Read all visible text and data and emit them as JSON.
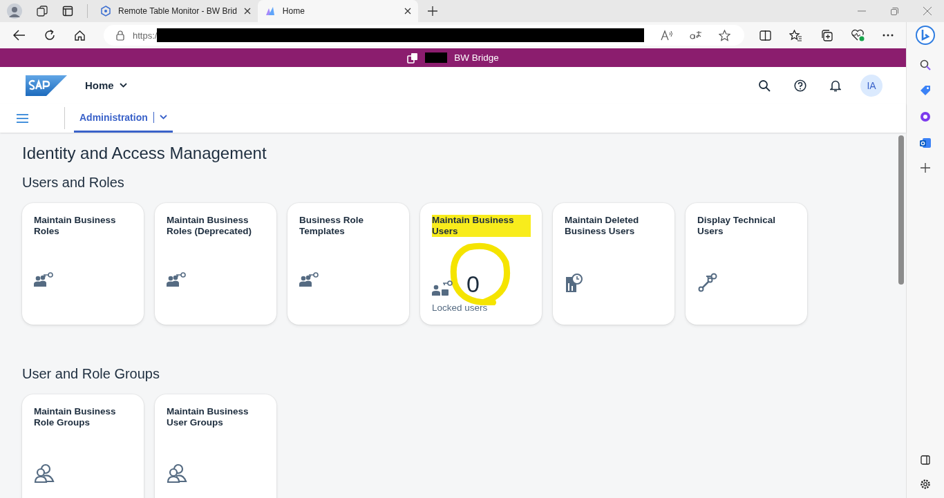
{
  "browser": {
    "tabs": [
      {
        "title": "Remote Table Monitor - BW Brid",
        "kind": "bw",
        "selected": false
      },
      {
        "title": "Home",
        "kind": "home",
        "selected": true
      }
    ],
    "address": "https:/"
  },
  "banner": {
    "title": "BW Bridge"
  },
  "shell": {
    "home": "Home",
    "user": "IA"
  },
  "nav": {
    "tabs": [
      {
        "label": "Administration",
        "selected": true
      }
    ]
  },
  "page_title": "Identity and Access Management",
  "sections": [
    {
      "title": "Users and Roles",
      "tiles": [
        {
          "title": "Maintain Business Roles",
          "kind": "roles",
          "highlighted": false
        },
        {
          "title": "Maintain Business Roles (Deprecated)",
          "kind": "roles",
          "highlighted": false
        },
        {
          "title": "Business Role Templates",
          "kind": "roles",
          "highlighted": false
        },
        {
          "title": "Maintain Business Users",
          "kind": "users",
          "highlighted": true,
          "number": "0",
          "footer": "Locked users"
        },
        {
          "title": "Maintain Deleted Business Users",
          "kind": "deleted",
          "highlighted": false
        },
        {
          "title": "Display Technical Users",
          "kind": "technical",
          "highlighted": false
        }
      ]
    },
    {
      "title": "User and Role Groups",
      "tiles": [
        {
          "title": "Maintain Business Role Groups",
          "kind": "group",
          "highlighted": false
        },
        {
          "title": "Maintain Business User Groups",
          "kind": "group",
          "highlighted": false
        }
      ]
    }
  ]
}
